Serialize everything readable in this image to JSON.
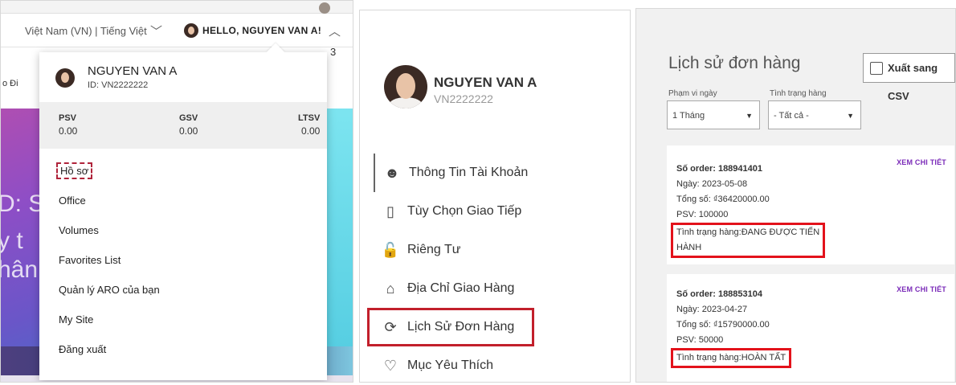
{
  "panel1": {
    "locale": "Việt Nam (VN) | Tiếng Việt",
    "greeting": "HELLO, NGUYEN VAN A!",
    "side_fragments": {
      "odi": "o Đi",
      "three": "3",
      "d": "D: S",
      "y": "y t",
      "han": "hân"
    },
    "dropdown": {
      "name": "NGUYEN VAN A",
      "id": "ID: VN2222222",
      "stats": [
        {
          "label": "PSV",
          "value": "0.00"
        },
        {
          "label": "GSV",
          "value": "0.00"
        },
        {
          "label": "LTSV",
          "value": "0.00"
        }
      ],
      "items": [
        "Hồ sơ",
        "Office",
        "Volumes",
        "Favorites List",
        "Quản lý ARO của bạn",
        "My Site",
        "Đăng xuất"
      ]
    }
  },
  "panel2": {
    "name": "NGUYEN VAN A",
    "id": "VN2222222",
    "nav": [
      {
        "label": "Thông Tin Tài Khoản",
        "icon": "user-circle-icon"
      },
      {
        "label": "Tùy Chọn Giao Tiếp",
        "icon": "phone-icon"
      },
      {
        "label": "Riêng Tư",
        "icon": "lock-icon"
      },
      {
        "label": "Địa Chỉ Giao Hàng",
        "icon": "home-icon"
      },
      {
        "label": "Lịch Sử Đơn Hàng",
        "icon": "history-icon"
      },
      {
        "label": "Mục Yêu Thích",
        "icon": "heart-icon"
      }
    ]
  },
  "panel3": {
    "title": "Lịch sử đơn hàng",
    "csv_button": "Xuất sang CSV",
    "filters": {
      "range_label": "Phạm vi ngày",
      "range_value": "1 Tháng",
      "status_label": "Tình trạng hàng",
      "status_value": "- Tất cả -"
    },
    "orders": [
      {
        "order_no": "Số order: 188941401",
        "date": "Ngày: 2023-05-08",
        "total": "Tổng số: ₫36420000.00",
        "psv": "PSV: 100000",
        "status_line1": "Tình trạng hàng:ĐANG ĐƯỢC TIẾN",
        "status_line2": "HÀNH",
        "detail_link": "XEM CHI TIẾT"
      },
      {
        "order_no": "Số order: 188853104",
        "date": "Ngày: 2023-04-27",
        "total": "Tổng số: ₫15790000.00",
        "psv": "PSV: 50000",
        "status_line1": "Tình trạng hàng:HOÀN TẤT",
        "detail_link": "XEM CHI TIẾT"
      }
    ]
  },
  "colors": {
    "highlight_red": "#e3121b",
    "link_purple": "#7a2ab8",
    "dashed_red": "#b0243b"
  }
}
